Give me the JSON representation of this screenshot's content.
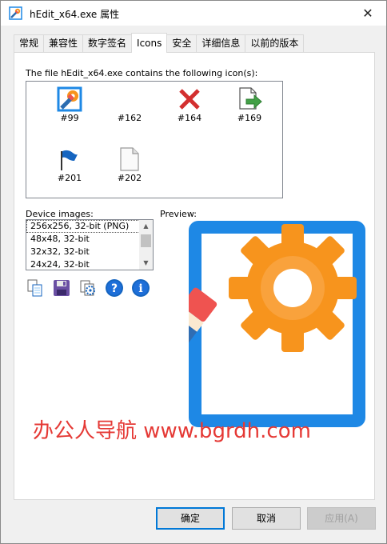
{
  "window": {
    "title": "hEdit_x64.exe 属性",
    "close_glyph": "✕"
  },
  "tabs": [
    {
      "label": "常规"
    },
    {
      "label": "兼容性"
    },
    {
      "label": "数字签名"
    },
    {
      "label": "Icons",
      "active": true
    },
    {
      "label": "安全"
    },
    {
      "label": "详细信息"
    },
    {
      "label": "以前的版本"
    }
  ],
  "icons_panel": {
    "file_label": "The file hEdit_x64.exe contains the following icon(s):",
    "icons": [
      {
        "id": "#99",
        "icon": "pencil-gear-icon"
      },
      {
        "id": "#162",
        "icon": "blank-icon"
      },
      {
        "id": "#164",
        "icon": "red-x-icon"
      },
      {
        "id": "#169",
        "icon": "document-arrow-icon"
      },
      {
        "id": "#201",
        "icon": "flag-icon"
      },
      {
        "id": "#202",
        "icon": "blank-page-icon"
      }
    ]
  },
  "device_images": {
    "label": "Device images:",
    "items": [
      "256x256, 32-bit (PNG)",
      "48x48, 32-bit",
      "32x32, 32-bit",
      "24x24, 32-bit"
    ]
  },
  "preview": {
    "label": "Preview:"
  },
  "actions": [
    {
      "name": "copy-icon"
    },
    {
      "name": "save-icon"
    },
    {
      "name": "settings-copy-icon"
    },
    {
      "name": "help-icon"
    },
    {
      "name": "info-icon"
    }
  ],
  "watermark": "办公人导航 www.bgrdh.com",
  "buttons": {
    "ok": "确定",
    "cancel": "取消",
    "apply": "应用(A)"
  },
  "colors": {
    "accent": "#0078d7",
    "watermark": "#e53935",
    "preview_frame": "#1e88e5",
    "gear": "#f7941d",
    "pencil": "#2b6cb0"
  }
}
